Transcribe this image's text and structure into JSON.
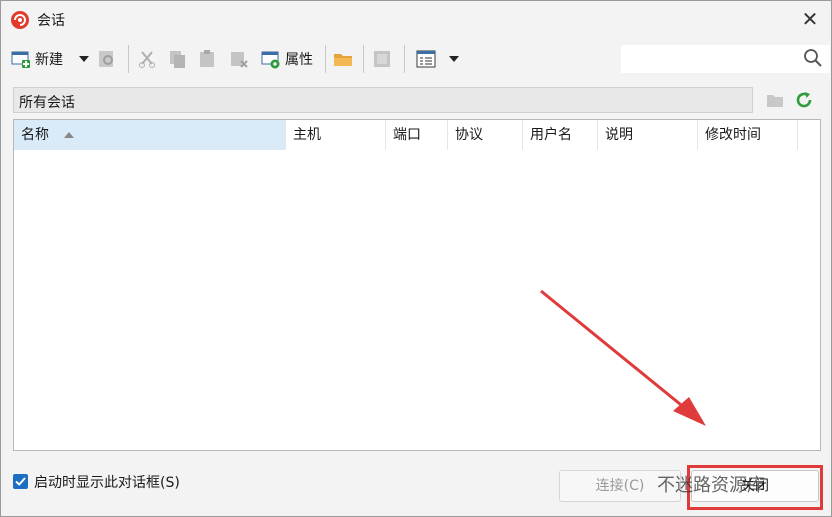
{
  "window": {
    "title": "会话"
  },
  "toolbar": {
    "new_label": "新建",
    "properties_label": "属性"
  },
  "search": {
    "placeholder": ""
  },
  "path": {
    "label": "所有会话"
  },
  "columns": [
    "名称",
    "主机",
    "端口",
    "协议",
    "用户名",
    "说明",
    "修改时间"
  ],
  "footer": {
    "show_on_startup_label": "启动时显示此对话框(S)",
    "show_on_startup_checked": true,
    "connect_label": "连接(C)",
    "close_label": "关闭"
  },
  "watermark": {
    "text": "不迷路资源库"
  },
  "colors": {
    "accent": "#1b6ec2",
    "highlight": "#e03a3a",
    "sorted_header": "#d9ebf9"
  }
}
